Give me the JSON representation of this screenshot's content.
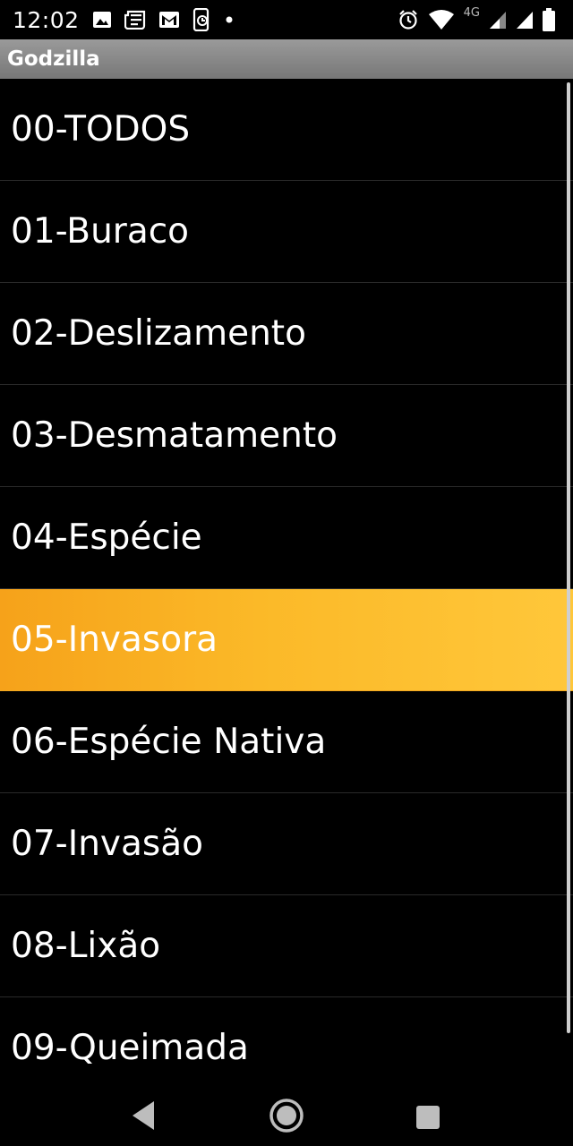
{
  "status_bar": {
    "time": "12:02",
    "network": "4G",
    "left_icons": [
      "image-icon",
      "news-icon",
      "gmail-icon",
      "phone-sync-icon",
      "dot-icon"
    ],
    "right_icons": [
      "alarm-icon",
      "wifi-icon",
      "signal-icon",
      "signal-icon",
      "battery-icon"
    ]
  },
  "app": {
    "title": "Godzilla"
  },
  "list": {
    "selected_index": 5,
    "selected_color": "#fbb928",
    "items": [
      {
        "label": "00-TODOS"
      },
      {
        "label": "01-Buraco"
      },
      {
        "label": "02-Deslizamento"
      },
      {
        "label": "03-Desmatamento"
      },
      {
        "label": "04-Espécie"
      },
      {
        "label": "05-Invasora"
      },
      {
        "label": "06-Espécie Nativa"
      },
      {
        "label": "07-Invasão"
      },
      {
        "label": "08-Lixão"
      },
      {
        "label": "09-Queimada"
      }
    ]
  },
  "nav_bar": {
    "buttons": [
      "back-icon",
      "home-icon",
      "recents-icon"
    ]
  }
}
